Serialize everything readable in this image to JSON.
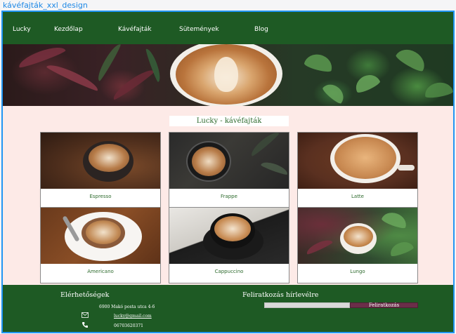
{
  "frame": {
    "label": "kávéfajták_xxl_design"
  },
  "nav": {
    "items": [
      {
        "label": "Lucky"
      },
      {
        "label": "Kezdőlap"
      },
      {
        "label": "Kávéfajták"
      },
      {
        "label": "Sütemények"
      },
      {
        "label": "Blog"
      }
    ]
  },
  "main": {
    "title": "Lucky - kávéfajták",
    "cards": [
      {
        "label": "Espresso"
      },
      {
        "label": "Frappe"
      },
      {
        "label": "Latte"
      },
      {
        "label": "Americano"
      },
      {
        "label": "Cappuccino"
      },
      {
        "label": "Lungo"
      }
    ]
  },
  "footer": {
    "contact_title": "Elérhetőségek",
    "address": "6900 Makó posta utca 4-6",
    "email": "lucky@gmail.com",
    "phone": "06703620371",
    "subscribe_title": "Feliratkozás hírlevélre",
    "subscribe_button": "Feliratkozás",
    "subscribe_placeholder": ""
  },
  "colors": {
    "nav_bg": "#1e5a24",
    "page_bg": "#fdeae7",
    "accent_green": "#2e6b2e",
    "button_bg": "#6b2e49",
    "frame_border": "#2196f3"
  }
}
